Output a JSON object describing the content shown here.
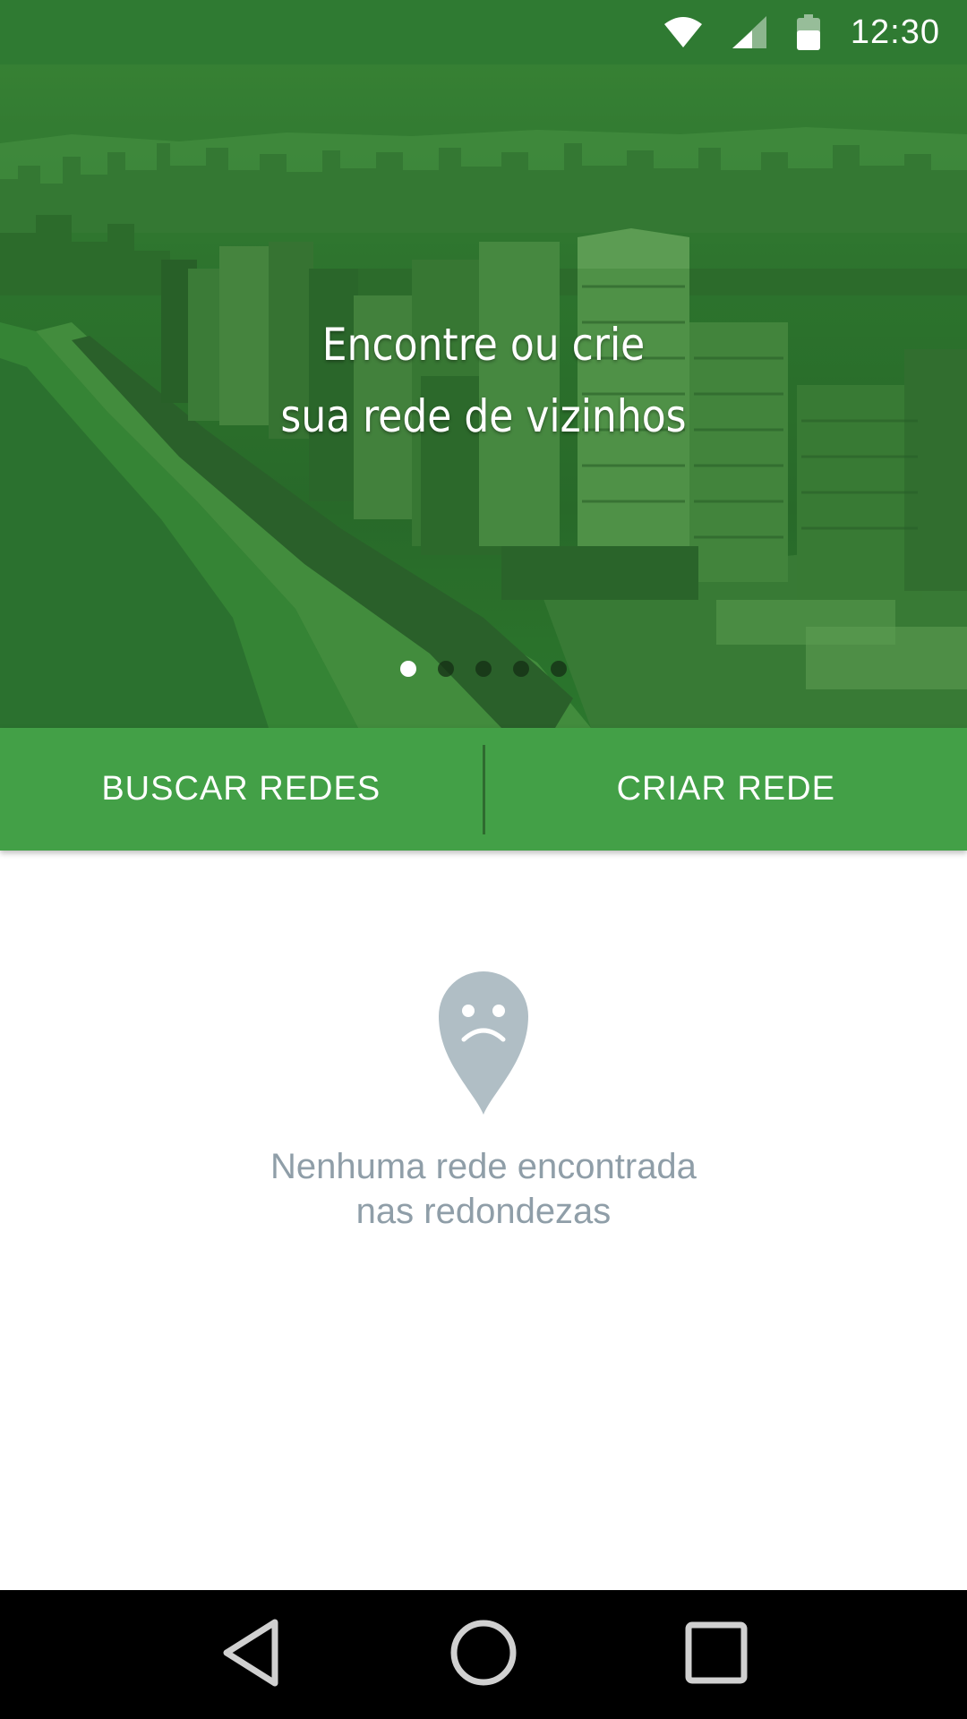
{
  "status_bar": {
    "time": "12:30",
    "icons": [
      "wifi-icon",
      "cell-signal-icon",
      "battery-icon"
    ]
  },
  "hero": {
    "title_line1": "Encontre ou crie",
    "title_line2": "sua rede de vizinhos",
    "pager": {
      "total": 5,
      "active": 1
    }
  },
  "actions": {
    "search_label": "BUSCAR REDES",
    "create_label": "CRIAR REDE"
  },
  "empty_state": {
    "icon": "sad-location-pin-icon",
    "line1": "Nenhuma rede encontrada",
    "line2": "nas redondezas"
  },
  "nav_bar": {
    "icons": [
      "back-icon",
      "home-icon",
      "recents-icon"
    ]
  },
  "colors": {
    "primary": "#43a047",
    "status_bar": "#2f7a32",
    "empty_text": "#8f9ea8",
    "pin": "#b0bec5"
  }
}
